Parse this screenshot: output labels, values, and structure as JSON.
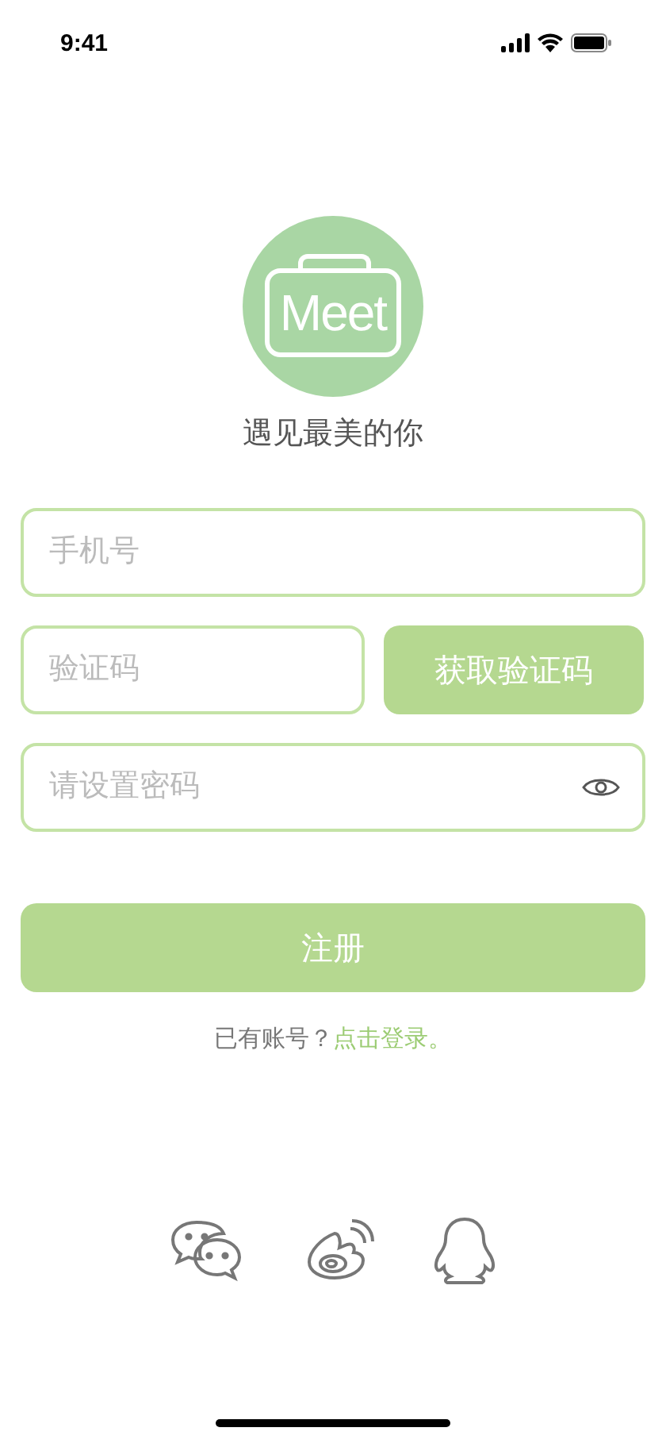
{
  "status_bar": {
    "time": "9:41"
  },
  "logo": {
    "text": "Meet"
  },
  "tagline": "遇见最美的你",
  "phone_field": {
    "placeholder": "手机号"
  },
  "code_field": {
    "placeholder": "验证码"
  },
  "code_button": "获取验证码",
  "password_field": {
    "placeholder": "请设置密码"
  },
  "register_button": "注册",
  "login_prompt": {
    "text": "已有账号？",
    "link": "点击登录。"
  },
  "social_logins": [
    {
      "kind": "chat"
    },
    {
      "kind": "weibo"
    },
    {
      "kind": "penguin"
    }
  ]
}
